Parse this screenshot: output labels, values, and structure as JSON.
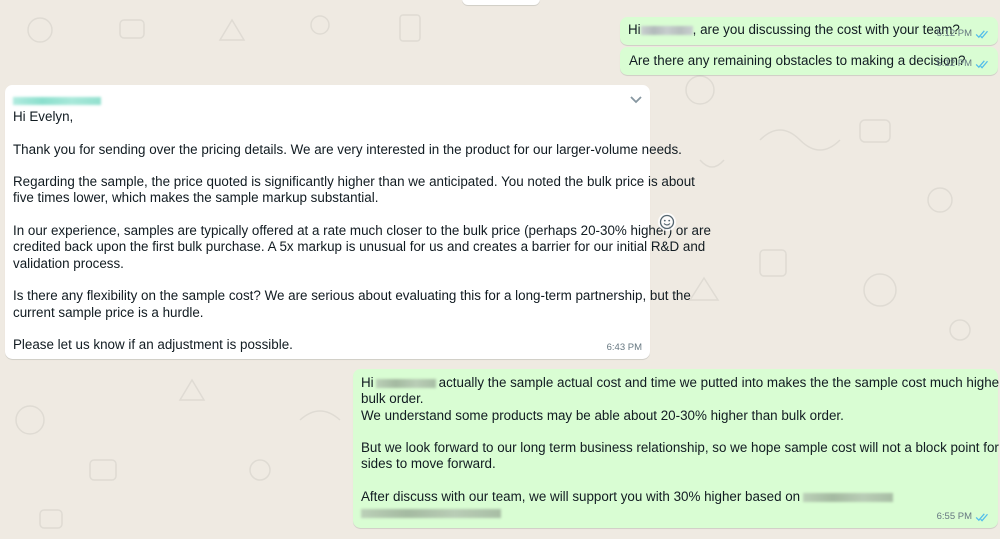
{
  "theme": {
    "background": "#efeae2",
    "outgoing_bubble": "#d9fdd3",
    "incoming_bubble": "#ffffff",
    "read_ticks": "#53bdeb",
    "meta_text": "#667781"
  },
  "messages": {
    "m1": {
      "prefix": "Hi",
      "text": ", are you discussing the cost with your team?",
      "time": "5:12 PM",
      "status_icon": "double-check-read-icon"
    },
    "m2": {
      "text": "Are there any remaining obstacles to making a decision?",
      "time": "5:12 PM",
      "status_icon": "double-check-read-icon"
    },
    "m3": {
      "greeting": "Hi Evelyn,",
      "p1": "Thank you for sending over the pricing details. We are very interested in the product for our larger-volume needs.",
      "p2a": "Regarding the sample, the price quoted is significantly higher than we anticipated. You noted the bulk price is about",
      "p2b": "five times lower, which makes the sample markup substantial.",
      "p3a": "In our experience, samples are typically offered at a rate much closer to the bulk price (perhaps 20-30% higher) or are",
      "p3b": "credited back upon the first bulk purchase. A 5x markup is unusual for us and creates a barrier for our initial R&D and",
      "p3c": "validation process.",
      "p4a": "Is there any flexibility on the sample cost? We are serious about evaluating this for a long-term partnership, but the",
      "p4b": "current sample price is a hurdle.",
      "p5": "Please let us know if an adjustment is possible.",
      "time": "6:43 PM"
    },
    "m4": {
      "prefix": "Hi",
      "l1": "actually the sample actual cost and time we putted into makes the the sample cost much higher than",
      "l2": "bulk order.",
      "l3": "We understand some products may be able about 20-30% higher than bulk order.",
      "l4a": "But we look forward to our long term business relationship, so we hope sample cost will not a block point for our two",
      "l4b": "sides to move forward.",
      "l5": "After discuss with our team, we will support you with 30% higher based on",
      "time": "6:55 PM",
      "status_icon": "double-check-read-icon"
    }
  }
}
